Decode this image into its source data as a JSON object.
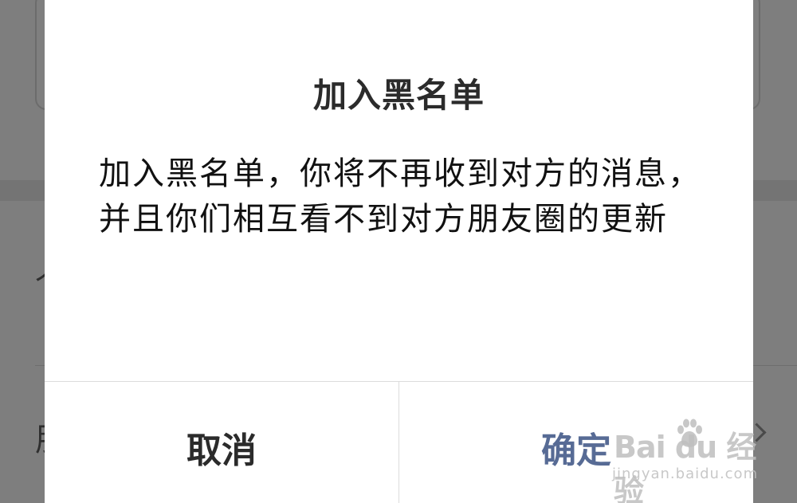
{
  "dialog": {
    "title": "加入黑名单",
    "message": "加入黑名单，你将不再收到对方的消息，并且你们相互看不到对方朋友圈的更新",
    "cancel_label": "取消",
    "confirm_label": "确定"
  },
  "background": {
    "glyph_top": "个",
    "glyph_bottom": "朋"
  },
  "watermark": {
    "brand": "Bai du 经验",
    "url": "jingyan.baidu.com"
  },
  "colors": {
    "overlay": "#7e7e7e",
    "dialog": "#ffffff",
    "confirm": "#576b95",
    "cancel": "#2b2b2b"
  }
}
